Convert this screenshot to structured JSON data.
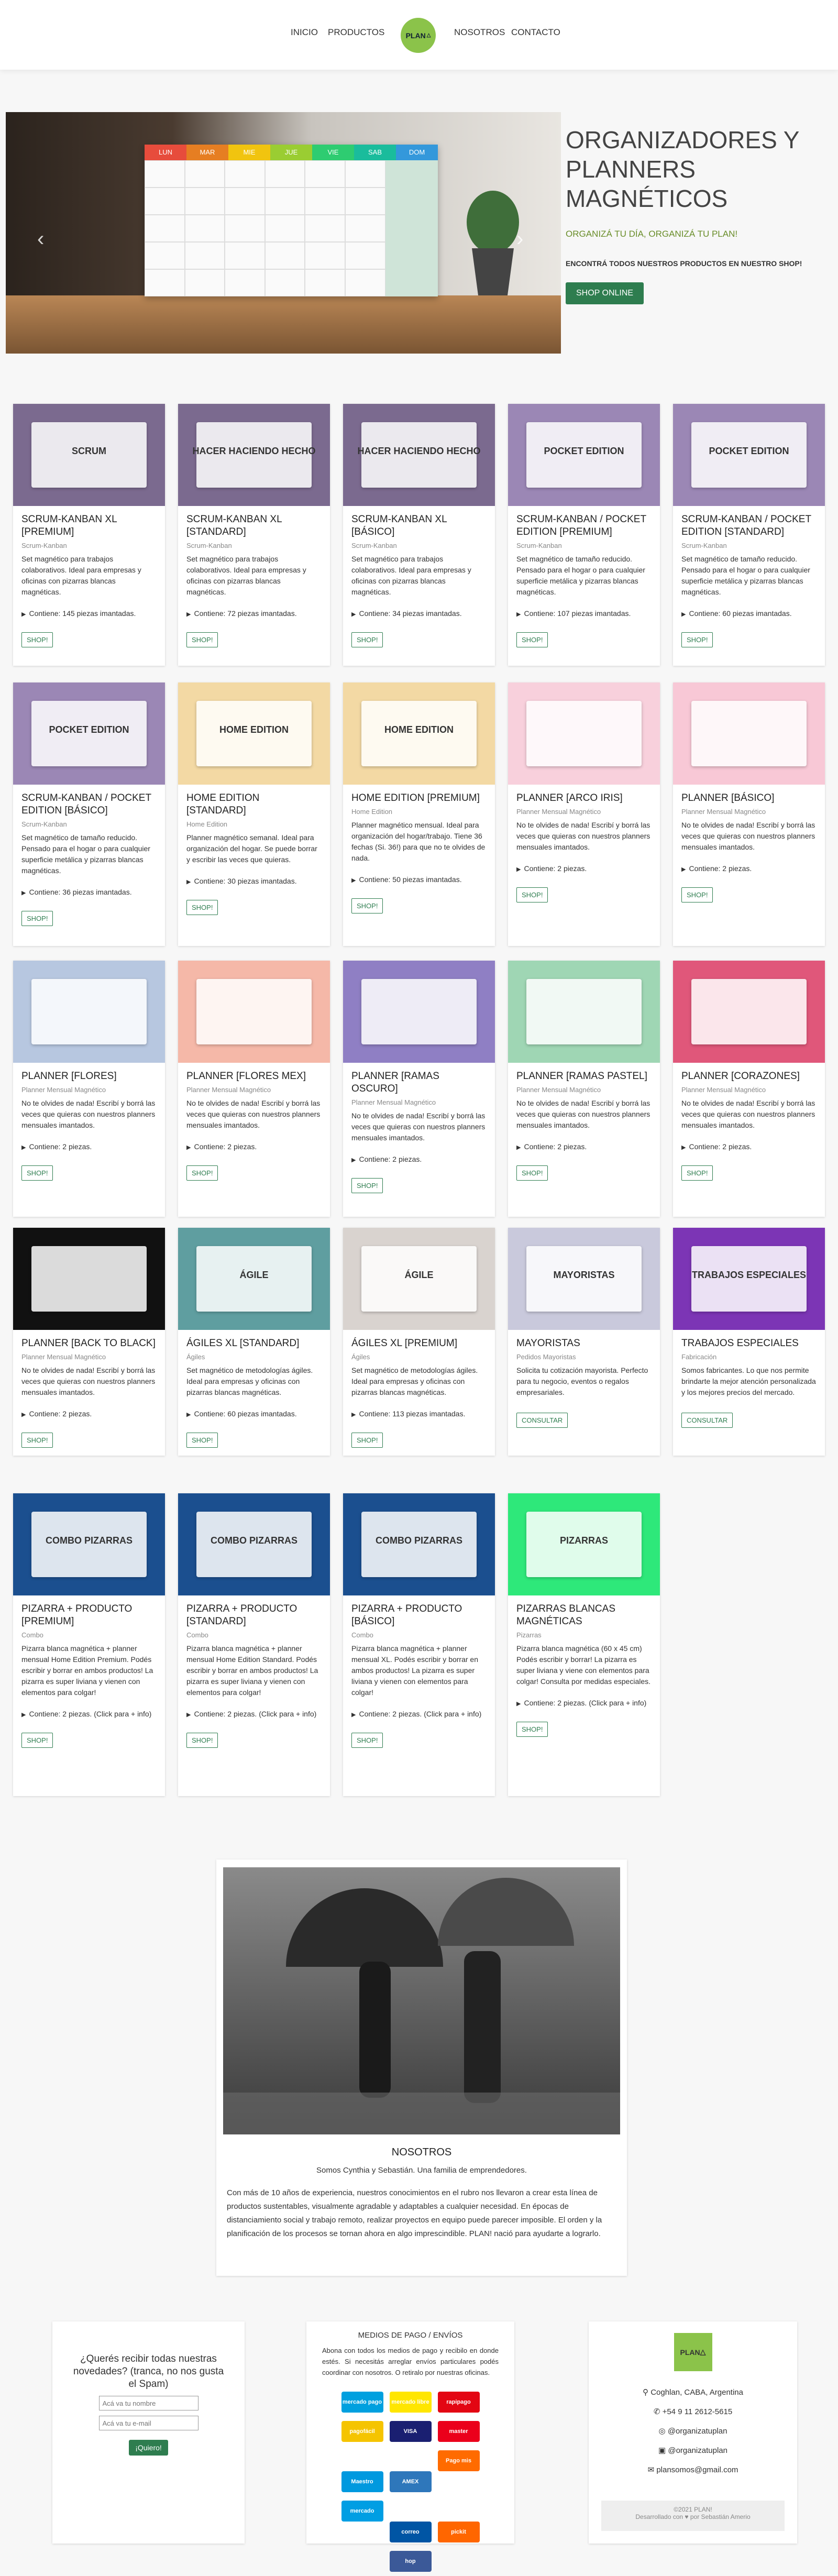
{
  "nav": {
    "inicio": "INICIO",
    "productos": "PRODUCTOS",
    "logo": "PLAN",
    "nosotros": "NOSOTROS",
    "contacto": "CONTACTO"
  },
  "hero": {
    "title": "ORGANIZADORES Y PLANNERS MAGNÉTICOS",
    "subtitle": "ORGANIZÁ TU DÍA, ORGANIZÁ TU PLAN!",
    "text": "ENCONTRÁ TODOS NUESTROS PRODUCTOS EN NUESTRO SHOP!",
    "button": "SHOP ONLINE",
    "days": [
      "LUN",
      "MAR",
      "MIE",
      "JUE",
      "VIE",
      "SAB",
      "DOM"
    ],
    "prev": "‹",
    "next": "›"
  },
  "shop_label": "SHOP!",
  "consult_label": "CONSULTAR",
  "products": [
    {
      "title": "SCRUM-KANBAN XL [PREMIUM]",
      "cat": "Scrum-Kanban",
      "desc": "Set magnético para trabajos colaborativos. Ideal para empresas y oficinas con pizarras blancas magnéticas.",
      "contains": "Contiene: 145 piezas imantadas.",
      "btn": "SHOP!",
      "bg": "#7b6a8f",
      "label": "SCRUM"
    },
    {
      "title": "SCRUM-KANBAN XL [STANDARD]",
      "cat": "Scrum-Kanban",
      "desc": "Set magnético para trabajos colaborativos. Ideal para empresas y oficinas con pizarras blancas magnéticas.",
      "contains": "Contiene: 72 piezas imantadas.",
      "btn": "SHOP!",
      "bg": "#7b6a8f",
      "label": "HACER HACIENDO HECHO"
    },
    {
      "title": "SCRUM-KANBAN XL [BÁSICO]",
      "cat": "Scrum-Kanban",
      "desc": "Set magnético para trabajos colaborativos. Ideal para empresas y oficinas con pizarras blancas magnéticas.",
      "contains": "Contiene: 34 piezas imantadas.",
      "btn": "SHOP!",
      "bg": "#7b6a8f",
      "label": "HACER HACIENDO HECHO"
    },
    {
      "title": "SCRUM-KANBAN / POCKET EDITION [PREMIUM]",
      "cat": "Scrum-Kanban",
      "desc": "Set magnético de tamaño reducido. Pensado para el hogar o para cualquier superficie metálica y pizarras blancas magnéticas.",
      "contains": "Contiene: 107 piezas imantadas.",
      "btn": "SHOP!",
      "bg": "#9b87b5",
      "label": "POCKET EDITION"
    },
    {
      "title": "SCRUM-KANBAN / POCKET EDITION [STANDARD]",
      "cat": "Scrum-Kanban",
      "desc": "Set magnético de tamaño reducido. Pensado para el hogar o para cualquier superficie metálica y pizarras blancas magnéticas.",
      "contains": "Contiene: 60 piezas imantadas.",
      "btn": "SHOP!",
      "bg": "#9b87b5",
      "label": "POCKET EDITION"
    },
    {
      "title": "SCRUM-KANBAN / POCKET EDITION [BÁSICO]",
      "cat": "Scrum-Kanban",
      "desc": "Set magnético de tamaño reducido. Pensado para el hogar o para cualquier superficie metálica y pizarras blancas magnéticas.",
      "contains": "Contiene: 36 piezas imantadas.",
      "btn": "SHOP!",
      "bg": "#9b87b5",
      "label": "POCKET EDITION"
    },
    {
      "title": "HOME EDITION [STANDARD]",
      "cat": "Home Edition",
      "desc": "Planner magnético semanal. Ideal para organización del hogar. Se puede borrar y escribir las veces que quieras.",
      "contains": "Contiene: 30 piezas imantadas.",
      "btn": "SHOP!",
      "bg": "#f3d9a4",
      "label": "HOME EDITION"
    },
    {
      "title": "HOME EDITION [PREMIUM]",
      "cat": "Home Edition",
      "desc": "Planner magnético mensual. Ideal para organización del hogar/trabajo. Tiene 36 fechas (Si. 36!) para que no te olvides de nada.",
      "contains": "Contiene: 50 piezas imantadas.",
      "btn": "SHOP!",
      "bg": "#f3d9a4",
      "label": "HOME EDITION"
    },
    {
      "title": "PLANNER [ARCO IRIS]",
      "cat": "Planner Mensual Magnético",
      "desc": "No te olvides de nada! Escribí y borrá las veces que quieras con nuestros planners mensuales imantados.",
      "contains": "Contiene: 2 piezas.",
      "btn": "SHOP!",
      "bg": "#f8d0dc",
      "label": ""
    },
    {
      "title": "PLANNER [BÁSICO]",
      "cat": "Planner Mensual Magnético",
      "desc": "No te olvides de nada! Escribí y borrá las veces que quieras con nuestros planners mensuales imantados.",
      "contains": "Contiene: 2 piezas.",
      "btn": "SHOP!",
      "bg": "#f8c8d6",
      "label": ""
    },
    {
      "title": "PLANNER [FLORES]",
      "cat": "Planner Mensual Magnético",
      "desc": "No te olvides de nada! Escribí y borrá las veces que quieras con nuestros planners mensuales imantados.",
      "contains": "Contiene: 2 piezas.",
      "btn": "SHOP!",
      "bg": "#b7c7e0",
      "label": ""
    },
    {
      "title": "PLANNER [FLORES MEX]",
      "cat": "Planner Mensual Magnético",
      "desc": "No te olvides de nada! Escribí y borrá las veces que quieras con nuestros planners mensuales imantados.",
      "contains": "Contiene: 2 piezas.",
      "btn": "SHOP!",
      "bg": "#f5b8a8",
      "label": ""
    },
    {
      "title": "PLANNER [RAMAS OSCURO]",
      "cat": "Planner Mensual Magnético",
      "desc": "No te olvides de nada! Escribí y borrá las veces que quieras con nuestros planners mensuales imantados.",
      "contains": "Contiene: 2 piezas.",
      "btn": "SHOP!",
      "bg": "#8f7fc4",
      "label": ""
    },
    {
      "title": "PLANNER [RAMAS PASTEL]",
      "cat": "Planner Mensual Magnético",
      "desc": "No te olvides de nada! Escribí y borrá las veces que quieras con nuestros planners mensuales imantados.",
      "contains": "Contiene: 2 piezas.",
      "btn": "SHOP!",
      "bg": "#9fd6b4",
      "label": ""
    },
    {
      "title": "PLANNER [CORAZONES]",
      "cat": "Planner Mensual Magnético",
      "desc": "No te olvides de nada! Escribí y borrá las veces que quieras con nuestros planners mensuales imantados.",
      "contains": "Contiene: 2 piezas.",
      "btn": "SHOP!",
      "bg": "#e0577a",
      "label": ""
    },
    {
      "title": "PLANNER [BACK TO BLACK]",
      "cat": "Planner Mensual Magnético",
      "desc": "No te olvides de nada! Escribí y borrá las veces que quieras con nuestros planners mensuales imantados.",
      "contains": "Contiene: 2 piezas.",
      "btn": "SHOP!",
      "bg": "#111111",
      "label": ""
    },
    {
      "title": "ÁGILES XL [STANDARD]",
      "cat": "Ágiles",
      "desc": "Set magnético de metodologías ágiles. Ideal para empresas y oficinas con pizarras blancas magnéticas.",
      "contains": "Contiene: 60 piezas imantadas.",
      "btn": "SHOP!",
      "bg": "#5f9ea0",
      "label": "ÁGILE"
    },
    {
      "title": "ÁGILES XL [PREMIUM]",
      "cat": "Ágiles",
      "desc": "Set magnético de metodologías ágiles. Ideal para empresas y oficinas con pizarras blancas magnéticas.",
      "contains": "Contiene: 113 piezas imantadas.",
      "btn": "SHOP!",
      "bg": "#d9d3cf",
      "label": "ÁGILE"
    },
    {
      "title": "MAYORISTAS",
      "cat": "Pedidos Mayoristas",
      "desc": "Solicita tu cotización mayorista. Perfecto para tu negocio, eventos o regalos empresariales.",
      "contains": "",
      "btn": "CONSULTAR",
      "bg": "#c9c9dc",
      "label": "MAYORISTAS"
    },
    {
      "title": "TRABAJOS ESPECIALES",
      "cat": "Fabricación",
      "desc": "Somos fabricantes. Lo que nos permite brindarte la mejor atención personalizada y los mejores precios del mercado.",
      "contains": "",
      "btn": "CONSULTAR",
      "bg": "#7c35b5",
      "label": "TRABAJOS ESPECIALES"
    },
    {
      "title": "PIZARRA + PRODUCTO [PREMIUM]",
      "cat": "Combo",
      "desc": "Pizarra blanca magnética + planner mensual Home Edition Premium. Podés escribir y borrar en ambos productos! La pizarra es super liviana y vienen con elementos para colgar!",
      "contains": "Contiene: 2 piezas. (Click para + info)",
      "btn": "SHOP!",
      "bg": "#1b4f8f",
      "label": "COMBO PIZARRAS"
    },
    {
      "title": "PIZARRA + PRODUCTO [STANDARD]",
      "cat": "Combo",
      "desc": "Pizarra blanca magnética + planner mensual Home Edition Standard. Podés escribir y borrar en ambos productos! La pizarra es super liviana y vienen con elementos para colgar!",
      "contains": "Contiene: 2 piezas. (Click para + info)",
      "btn": "SHOP!",
      "bg": "#1b4f8f",
      "label": "COMBO PIZARRAS"
    },
    {
      "title": "PIZARRA + PRODUCTO [BÁSICO]",
      "cat": "Combo",
      "desc": "Pizarra blanca magnética + planner mensual XL. Podés escribir y borrar en ambos productos! La pizarra es super liviana y vienen con elementos para colgar!",
      "contains": "Contiene: 2 piezas. (Click para + info)",
      "btn": "SHOP!",
      "bg": "#1b4f8f",
      "label": "COMBO PIZARRAS"
    },
    {
      "title": "PIZARRAS BLANCAS MAGNÉTICAS",
      "cat": "Pizarras",
      "desc": "Pizarra blanca magnética (60 x 45 cm) Podés escribir y borrar! La pizarra es super liviana y viene con elementos para colgar! Consulta por medidas especiales.",
      "contains": "Contiene: 2 piezas. (Click para + info)",
      "btn": "SHOP!",
      "bg": "#2ee87a",
      "label": "PIZARRAS"
    }
  ],
  "about": {
    "title": "NOSOTROS",
    "intro": "Somos Cynthia y Sebastián. Una familia de emprendedores.",
    "text": "Con más de 10 años de experiencia, nuestros conocimientos en el rubro nos llevaron a crear esta línea de productos sustentables, visualmente agradable y adaptables a cualquier necesidad. En épocas de distanciamiento social y trabajo remoto, realizar proyectos en equipo puede parecer imposible. El orden y la planificación de los procesos se tornan ahora en algo imprescindible. PLAN! nació para ayudarte a lograrlo."
  },
  "newsletter": {
    "title": "¿Querés recibir todas nuestras novedades? (tranca, no nos gusta el Spam)",
    "name_ph": "Acá va tu nombre",
    "email_ph": "Acá va tu e-mail",
    "button": "¡Quiero!"
  },
  "payments": {
    "title": "MEDIOS DE PAGO / ENVÍOS",
    "text": "Abona con todos los medios de pago y recibilo en donde estés. Si necesitás arreglar envíos particulares podés coordinar con nosotros. O retiralo por nuestras oficinas.",
    "logos": [
      "mercado pago",
      "mercado libre",
      "rapipago",
      "pagofácil",
      "VISA",
      "master",
      "Maestro",
      "AMEX",
      "Pago mis Cuentas",
      "mercado envíos",
      "correo",
      "pickit",
      "hop"
    ]
  },
  "contact": {
    "logo": "PLAN",
    "address": "Coghlan, CABA, Argentina",
    "phone": "+54 9 11 2612-5615",
    "instagram": "@organizatuplan",
    "facebook": "@organizatuplan",
    "email": "plansomos@gmail.com",
    "copyright": "©2021 PLAN!",
    "credit": "Desarrollado con ♥ por Sebastián Amerio"
  }
}
